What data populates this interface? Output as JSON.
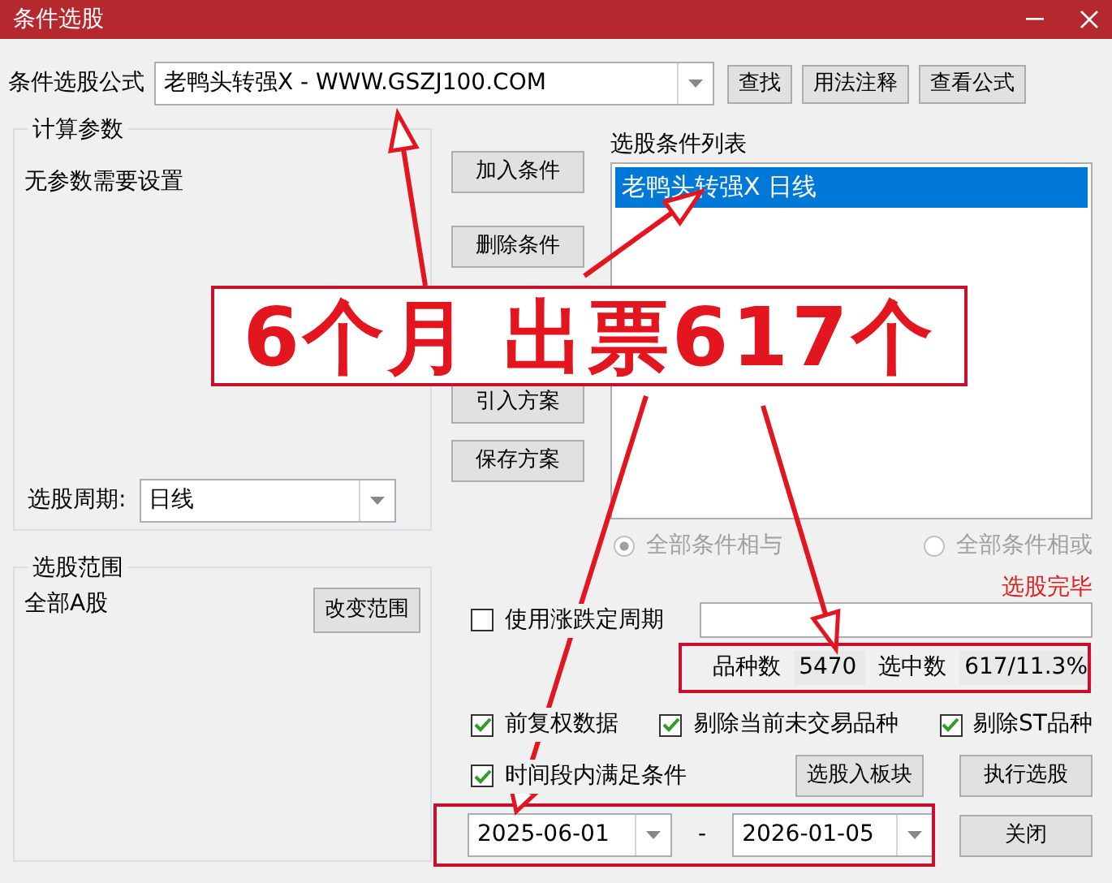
{
  "window": {
    "title": "条件选股"
  },
  "formula": {
    "label": "条件选股公式",
    "value": "老鸭头转强X  -  WWW.GSZJ100.COM",
    "buttons": [
      "查找",
      "用法注释",
      "查看公式"
    ]
  },
  "params": {
    "title": "计算参数",
    "message": "无参数需要设置",
    "period_label": "选股周期:",
    "period_value": "日线"
  },
  "middle_buttons": [
    "加入条件",
    "删除条件",
    "引入方案",
    "保存方案"
  ],
  "condition_list": {
    "title": "选股条件列表",
    "items": [
      {
        "label": "老鸭头转强X  日线",
        "selected": true
      }
    ]
  },
  "logic": [
    {
      "label": "全部条件相与",
      "selected": true,
      "disabled": true
    },
    {
      "label": "全部条件相或",
      "selected": false,
      "disabled": true
    }
  ],
  "scope": {
    "title": "选股范围",
    "value": "全部A股",
    "button": "改变范围"
  },
  "status": "选股完毕",
  "period_option": {
    "label": "使用涨跌定周期",
    "checked": false
  },
  "stats": [
    {
      "label": "品种数",
      "value": "5470"
    },
    {
      "label": "选中数",
      "value": "617/11.3%"
    }
  ],
  "options": [
    {
      "label": "前复权数据",
      "checked": true
    },
    {
      "label": "剔除当前未交易品种",
      "checked": true
    },
    {
      "label": "剔除ST品种",
      "checked": true
    }
  ],
  "time_option": {
    "label": "时间段内满足条件",
    "checked": true
  },
  "date_from": "2025-06-01",
  "date_separator": "-",
  "date_to": "2026-01-05",
  "action_buttons": [
    "选股入板块",
    "执行选股",
    "关闭"
  ],
  "annotation": {
    "banner": "6个月 出票617个"
  }
}
